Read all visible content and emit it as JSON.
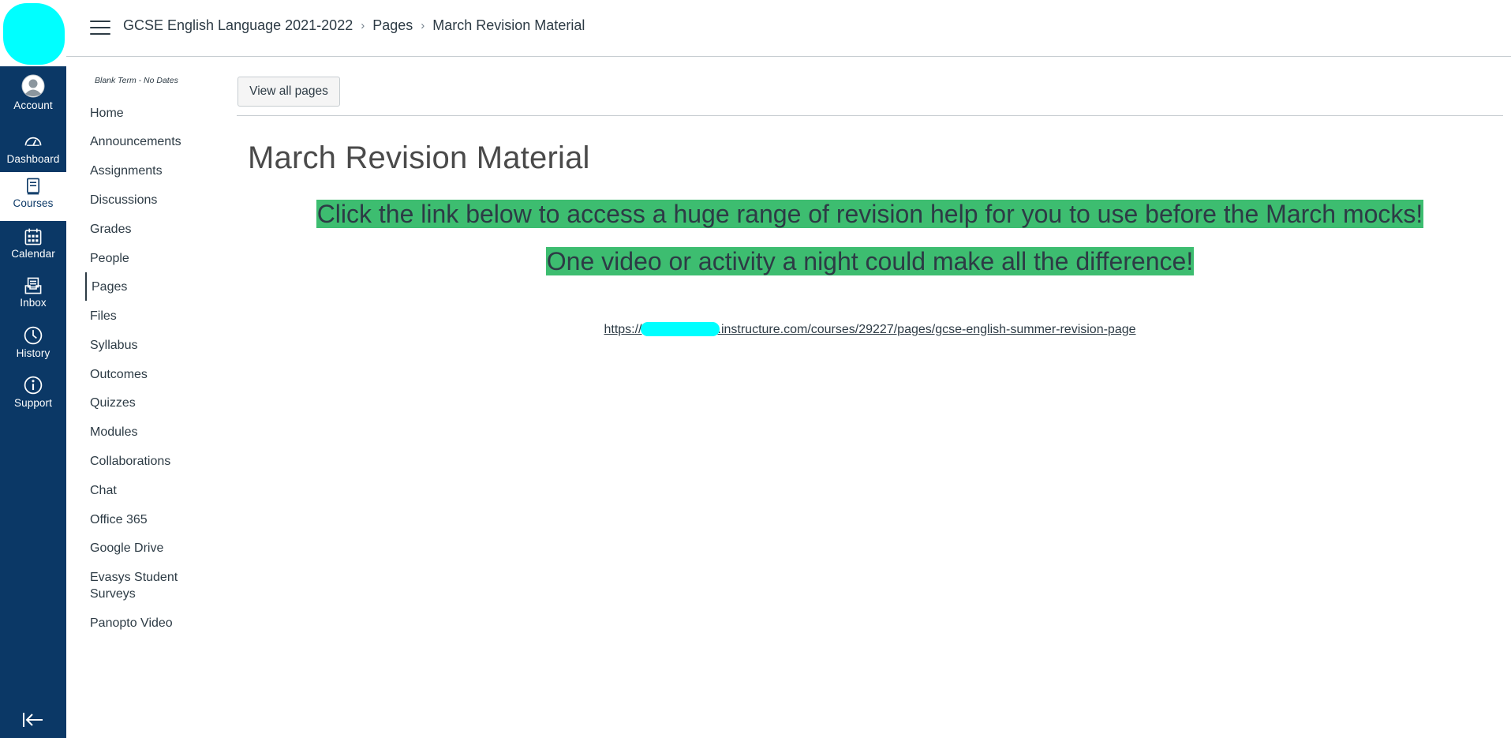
{
  "global_nav": {
    "items": [
      {
        "label": "Account",
        "icon": "account-icon"
      },
      {
        "label": "Dashboard",
        "icon": "dashboard-icon"
      },
      {
        "label": "Courses",
        "icon": "courses-icon",
        "active": true
      },
      {
        "label": "Calendar",
        "icon": "calendar-icon"
      },
      {
        "label": "Inbox",
        "icon": "inbox-icon"
      },
      {
        "label": "History",
        "icon": "history-icon"
      },
      {
        "label": "Support",
        "icon": "support-icon"
      }
    ],
    "colors": {
      "background": "#0b3866",
      "active_background": "#ffffff",
      "logo_redaction": "#00ffff"
    }
  },
  "breadcrumb": {
    "course": "GCSE English Language 2021-2022",
    "section": "Pages",
    "current": "March Revision Material"
  },
  "course_nav": {
    "term": "Blank Term - No Dates",
    "items": [
      {
        "label": "Home"
      },
      {
        "label": "Announcements"
      },
      {
        "label": "Assignments"
      },
      {
        "label": "Discussions"
      },
      {
        "label": "Grades"
      },
      {
        "label": "People"
      },
      {
        "label": "Pages",
        "active": true
      },
      {
        "label": "Files"
      },
      {
        "label": "Syllabus"
      },
      {
        "label": "Outcomes"
      },
      {
        "label": "Quizzes"
      },
      {
        "label": "Modules"
      },
      {
        "label": "Collaborations"
      },
      {
        "label": "Chat"
      },
      {
        "label": "Office 365"
      },
      {
        "label": "Google Drive"
      },
      {
        "label": "Evasys Student Surveys"
      },
      {
        "label": "Panopto Video"
      }
    ]
  },
  "main": {
    "view_all_label": "View all pages",
    "title": "March Revision Material",
    "highlight_1": "Click the link below to access a huge range of revision help for you to use before the March mocks!",
    "highlight_2": "One video or activity a night could make all the difference!",
    "highlight_color": "#3dbd70",
    "link_prefix": "https://",
    "link_suffix": ".instructure.com/courses/29227/pages/gcse-english-summer-revision-page"
  }
}
